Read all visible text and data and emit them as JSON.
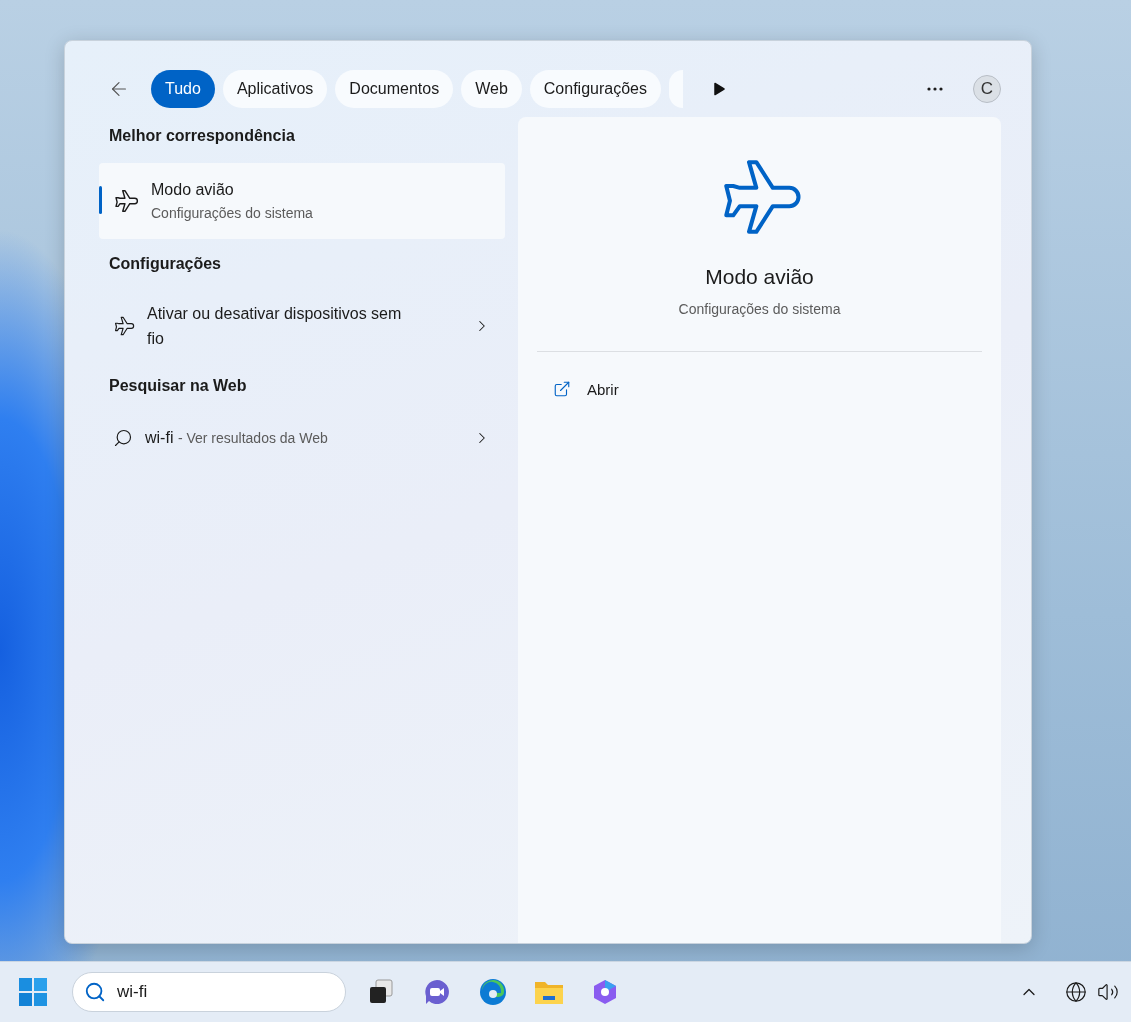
{
  "search_panel": {
    "tabs": [
      {
        "label": "Tudo",
        "selected": true
      },
      {
        "label": "Aplicativos",
        "selected": false
      },
      {
        "label": "Documentos",
        "selected": false
      },
      {
        "label": "Web",
        "selected": false
      },
      {
        "label": "Configurações",
        "selected": false
      }
    ],
    "account_initial": "C",
    "best_match_heading": "Melhor correspondência",
    "best_match": {
      "title": "Modo avião",
      "subtitle": "Configurações do sistema",
      "selected": true
    },
    "sections": [
      {
        "heading": "Configurações",
        "items": [
          {
            "kind": "setting",
            "title": "Ativar ou desativar dispositivos sem fio"
          }
        ]
      },
      {
        "heading": "Pesquisar na Web",
        "items": [
          {
            "kind": "web",
            "query": "wi-fi",
            "suffix": "- Ver resultados da Web"
          }
        ]
      }
    ],
    "preview": {
      "title": "Modo avião",
      "subtitle": "Configurações do sistema",
      "actions": [
        {
          "label": "Abrir"
        }
      ]
    }
  },
  "taskbar": {
    "search_value": "wi-fi"
  }
}
